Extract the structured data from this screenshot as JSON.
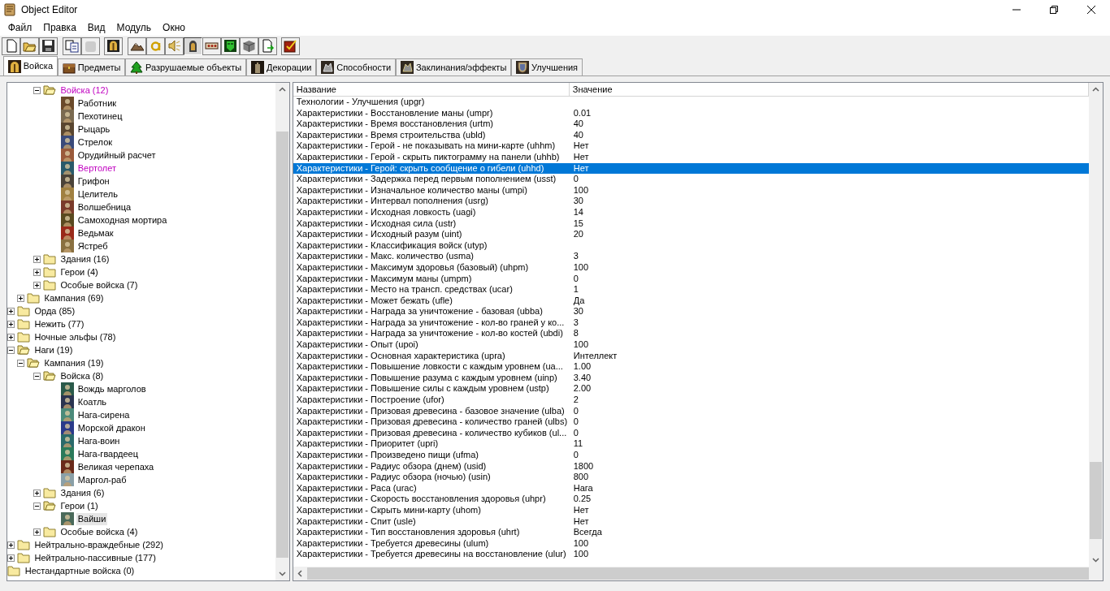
{
  "window": {
    "title": "Object Editor"
  },
  "menu": [
    "Файл",
    "Правка",
    "Вид",
    "Модуль",
    "Окно"
  ],
  "toolbar": [
    [
      {
        "kind": "new",
        "pressed": false,
        "disabled": false
      },
      {
        "kind": "open",
        "pressed": false,
        "disabled": false
      },
      {
        "kind": "save",
        "pressed": false,
        "disabled": false
      }
    ],
    [
      {
        "kind": "copy",
        "pressed": false,
        "disabled": false
      },
      {
        "kind": "paste",
        "pressed": false,
        "disabled": true
      }
    ],
    [
      {
        "kind": "helmet",
        "pressed": false,
        "disabled": false
      }
    ],
    [
      {
        "kind": "terrain",
        "pressed": false,
        "disabled": false
      },
      {
        "kind": "letter",
        "pressed": false,
        "disabled": false
      },
      {
        "kind": "sound",
        "pressed": false,
        "disabled": false
      },
      {
        "kind": "unit",
        "pressed": true,
        "disabled": false
      },
      {
        "kind": "sign",
        "pressed": false,
        "disabled": false
      },
      {
        "kind": "mask",
        "pressed": false,
        "disabled": false
      },
      {
        "kind": "cube",
        "pressed": false,
        "disabled": false
      },
      {
        "kind": "export",
        "pressed": false,
        "disabled": false
      }
    ],
    [
      {
        "kind": "checklist",
        "pressed": false,
        "disabled": false
      }
    ]
  ],
  "tabs": [
    {
      "kind": "units",
      "label": "Войска",
      "selected": true
    },
    {
      "kind": "items",
      "label": "Предметы",
      "selected": false
    },
    {
      "kind": "destructibles",
      "label": "Разрушаемые объекты",
      "selected": false
    },
    {
      "kind": "doodads",
      "label": "Декорации",
      "selected": false
    },
    {
      "kind": "abilities",
      "label": "Способности",
      "selected": false
    },
    {
      "kind": "buffs",
      "label": "Заклинания/эффекты",
      "selected": false
    },
    {
      "kind": "upgrades",
      "label": "Улучшения",
      "selected": false
    }
  ],
  "tree": [
    {
      "children": [
        {
          "children": [
            {
              "kind": "folder",
              "label": "Войска (12)",
              "expanded": true,
              "modified": true,
              "selected": false,
              "children": [
                {
                  "kind": "unit",
                  "label": "Работник",
                  "color": "#6b4a2a",
                  "modified": false,
                  "selected": false
                },
                {
                  "kind": "unit",
                  "label": "Пехотинец",
                  "color": "#7a6a50",
                  "modified": false,
                  "selected": false
                },
                {
                  "kind": "unit",
                  "label": "Рыцарь",
                  "color": "#5a4630",
                  "modified": false,
                  "selected": false
                },
                {
                  "kind": "unit",
                  "label": "Стрелок",
                  "color": "#3a4a7a",
                  "modified": false,
                  "selected": false
                },
                {
                  "kind": "unit",
                  "label": "Орудийный расчет",
                  "color": "#9a5a3a",
                  "modified": false,
                  "selected": false
                },
                {
                  "kind": "unit",
                  "label": "Вертолет",
                  "color": "#2a5a6a",
                  "modified": true,
                  "selected": false
                },
                {
                  "kind": "unit",
                  "label": "Грифон",
                  "color": "#4a4238",
                  "modified": false,
                  "selected": false
                },
                {
                  "kind": "unit",
                  "label": "Целитель",
                  "color": "#a08040",
                  "modified": false,
                  "selected": false
                },
                {
                  "kind": "unit",
                  "label": "Волшебница",
                  "color": "#7a3a2a",
                  "modified": false,
                  "selected": false
                },
                {
                  "kind": "unit",
                  "label": "Самоходная мортира",
                  "color": "#5a4a20",
                  "modified": false,
                  "selected": false
                },
                {
                  "kind": "unit",
                  "label": "Ведьмак",
                  "color": "#9a2a1a",
                  "modified": false,
                  "selected": false
                },
                {
                  "kind": "unit",
                  "label": "Ястреб",
                  "color": "#8a7040",
                  "modified": false,
                  "selected": false
                }
              ]
            },
            {
              "kind": "folder",
              "label": "Здания (16)",
              "expanded": false,
              "modified": false,
              "selected": false
            },
            {
              "kind": "folder",
              "label": "Герои (4)",
              "expanded": false,
              "modified": false,
              "selected": false
            },
            {
              "kind": "folder",
              "label": "Особые войска (7)",
              "expanded": false,
              "modified": false,
              "selected": false
            }
          ]
        },
        {
          "kind": "folder",
          "label": "Кампания (69)",
          "expanded": false,
          "modified": false,
          "selected": false
        }
      ]
    },
    {
      "kind": "folder",
      "label": "Орда (85)",
      "expanded": false,
      "modified": false,
      "selected": false
    },
    {
      "kind": "folder",
      "label": "Нежить (77)",
      "expanded": false,
      "modified": false,
      "selected": false
    },
    {
      "kind": "folder",
      "label": "Ночные эльфы (78)",
      "expanded": false,
      "modified": false,
      "selected": false
    },
    {
      "kind": "folder",
      "label": "Наги (19)",
      "expanded": true,
      "modified": false,
      "selected": false,
      "children": [
        {
          "kind": "folder",
          "label": "Кампания (19)",
          "expanded": true,
          "modified": false,
          "selected": false,
          "children": [
            {
              "kind": "folder",
              "label": "Войска (8)",
              "expanded": true,
              "modified": false,
              "selected": false,
              "children": [
                {
                  "kind": "unit",
                  "label": "Вождь марголов",
                  "color": "#2a5a4a",
                  "modified": false,
                  "selected": false
                },
                {
                  "kind": "unit",
                  "label": "Коатль",
                  "color": "#2a3450",
                  "modified": false,
                  "selected": false
                },
                {
                  "kind": "unit",
                  "label": "Нага-сирена",
                  "color": "#4a8a7a",
                  "modified": false,
                  "selected": false
                },
                {
                  "kind": "unit",
                  "label": "Морской дракон",
                  "color": "#2a3a8a",
                  "modified": false,
                  "selected": false
                },
                {
                  "kind": "unit",
                  "label": "Нага-воин",
                  "color": "#2a6a6a",
                  "modified": false,
                  "selected": false
                },
                {
                  "kind": "unit",
                  "label": "Нага-гвардеец",
                  "color": "#2a7a5a",
                  "modified": false,
                  "selected": false
                },
                {
                  "kind": "unit",
                  "label": "Великая черепаха",
                  "color": "#6a2a1a",
                  "modified": false,
                  "selected": false
                },
                {
                  "kind": "unit",
                  "label": "Маргол-раб",
                  "color": "#8aa0a8",
                  "modified": false,
                  "selected": false
                }
              ]
            },
            {
              "kind": "folder",
              "label": "Здания (6)",
              "expanded": false,
              "modified": false,
              "selected": false
            },
            {
              "kind": "folder",
              "label": "Герои (1)",
              "expanded": true,
              "modified": false,
              "selected": false,
              "children": [
                {
                  "kind": "unit",
                  "label": "Вайши",
                  "color": "#4a6a5a",
                  "modified": false,
                  "selected": true
                }
              ]
            },
            {
              "kind": "folder",
              "label": "Особые войска (4)",
              "expanded": false,
              "modified": false,
              "selected": false
            }
          ]
        }
      ]
    },
    {
      "kind": "folder",
      "label": "Нейтрально-враждебные (292)",
      "expanded": false,
      "modified": false,
      "selected": false
    },
    {
      "kind": "folder",
      "label": "Нейтрально-пассивные (177)",
      "expanded": false,
      "modified": false,
      "selected": false
    },
    {
      "kind": "empty-folder",
      "label": "Нестандартные войска (0)",
      "modified": false,
      "selected": false
    }
  ],
  "table": {
    "columns": [
      "Название",
      "Значение"
    ],
    "rows": [
      {
        "name": "Технологии - Улучшения (upgr)",
        "selected": false
      },
      {
        "name": "Характеристики - Восстановление маны (umpr)",
        "value": "0.01",
        "selected": false
      },
      {
        "name": "Характеристики - Время восстановления (urtm)",
        "value": "40",
        "selected": false
      },
      {
        "name": "Характеристики - Время строительства (ubld)",
        "value": "40",
        "selected": false
      },
      {
        "name": "Характеристики - Герой - не показывать на мини-карте (uhhm)",
        "value": "Нет",
        "selected": false
      },
      {
        "name": "Характеристики - Герой - скрыть пиктограмму на панели (uhhb)",
        "value": "Нет",
        "selected": false
      },
      {
        "name": "Характеристики - Герой: скрыть сообщение о гибели (uhhd)",
        "value": "Нет",
        "selected": true
      },
      {
        "name": "Характеристики - Задержка перед первым пополнением (usst)",
        "value": "0",
        "selected": false
      },
      {
        "name": "Характеристики - Изначальное количество маны (umpi)",
        "value": "100",
        "selected": false
      },
      {
        "name": "Характеристики - Интервал пополнения (usrg)",
        "value": "30",
        "selected": false
      },
      {
        "name": "Характеристики - Исходная ловкость (uagi)",
        "value": "14",
        "selected": false
      },
      {
        "name": "Характеристики - Исходная сила (ustr)",
        "value": "15",
        "selected": false
      },
      {
        "name": "Характеристики - Исходный разум (uint)",
        "value": "20",
        "selected": false
      },
      {
        "name": "Характеристики - Классификация войск (utyp)",
        "selected": false
      },
      {
        "name": "Характеристики - Макс. количество (usma)",
        "value": "3",
        "selected": false
      },
      {
        "name": "Характеристики - Максимум здоровья (базовый) (uhpm)",
        "value": "100",
        "selected": false
      },
      {
        "name": "Характеристики - Максимум маны (umpm)",
        "value": "0",
        "selected": false
      },
      {
        "name": "Характеристики - Место на трансп. средствах (ucar)",
        "value": "1",
        "selected": false
      },
      {
        "name": "Характеристики - Может бежать (ufle)",
        "value": "Да",
        "selected": false
      },
      {
        "name": "Характеристики - Награда за уничтожение - базовая (ubba)",
        "value": "30",
        "selected": false
      },
      {
        "name": "Характеристики - Награда за уничтожение - кол-во граней у ко...",
        "value": "3",
        "selected": false
      },
      {
        "name": "Характеристики - Награда за уничтожение - кол-во костей (ubdi)",
        "value": "8",
        "selected": false
      },
      {
        "name": "Характеристики - Опыт (upoi)",
        "value": "100",
        "selected": false
      },
      {
        "name": "Характеристики - Основная характеристика (upra)",
        "value": "Интеллект",
        "selected": false
      },
      {
        "name": "Характеристики - Повышение ловкости с каждым уровнем (ua...",
        "value": "1.00",
        "selected": false
      },
      {
        "name": "Характеристики - Повышение разума с каждым уровнем (uinp)",
        "value": "3.40",
        "selected": false
      },
      {
        "name": "Характеристики - Повышение силы с каждым уровнем (ustp)",
        "value": "2.00",
        "selected": false
      },
      {
        "name": "Характеристики - Построение (ufor)",
        "value": "2",
        "selected": false
      },
      {
        "name": "Характеристики - Призовая древесина - базовое значение (ulba)",
        "value": "0",
        "selected": false
      },
      {
        "name": "Характеристики - Призовая древесина - количество граней (ulbs)",
        "value": "0",
        "selected": false
      },
      {
        "name": "Характеристики - Призовая древесина - количество кубиков (ul...",
        "value": "0",
        "selected": false
      },
      {
        "name": "Характеристики - Приоритет (upri)",
        "value": "11",
        "selected": false
      },
      {
        "name": "Характеристики - Произведено пищи (ufma)",
        "value": "0",
        "selected": false
      },
      {
        "name": "Характеристики - Радиус обзора (днем) (usid)",
        "value": "1800",
        "selected": false
      },
      {
        "name": "Характеристики - Радиус обзора (ночью) (usin)",
        "value": "800",
        "selected": false
      },
      {
        "name": "Характеристики - Раса (urac)",
        "value": "Нага",
        "selected": false
      },
      {
        "name": "Характеристики - Скорость восстановления здоровья (uhpr)",
        "value": "0.25",
        "selected": false
      },
      {
        "name": "Характеристики - Скрыть мини-карту (uhom)",
        "value": "Нет",
        "selected": false
      },
      {
        "name": "Характеристики - Спит (usle)",
        "value": "Нет",
        "selected": false
      },
      {
        "name": "Характеристики - Тип восстановления здоровья (uhrt)",
        "value": "Всегда",
        "selected": false
      },
      {
        "name": "Характеристики - Требуется древесины (ulum)",
        "value": "100",
        "selected": false
      },
      {
        "name": "Характеристики - Требуется древесины на восстановление (ulur)",
        "value": "100",
        "selected": false
      }
    ]
  }
}
